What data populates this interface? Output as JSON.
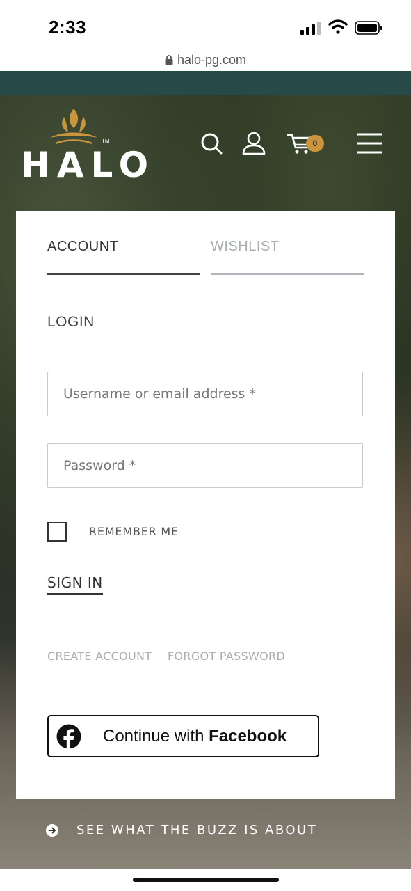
{
  "status": {
    "time": "2:33"
  },
  "browser": {
    "url": "halo-pg.com"
  },
  "header": {
    "logo_text": "HALO",
    "logo_tm": "TM",
    "cart_count": "0"
  },
  "tabs": [
    {
      "label": "ACCOUNT",
      "active": true
    },
    {
      "label": "WISHLIST",
      "active": false
    }
  ],
  "login": {
    "heading": "LOGIN",
    "username_placeholder": "Username or email address *",
    "password_placeholder": "Password *",
    "remember_label": "REMEMBER ME",
    "sign_in_label": "SIGN IN",
    "create_account_label": "CREATE ACCOUNT",
    "forgot_password_label": "FORGOT PASSWORD",
    "facebook_prefix": "Continue with ",
    "facebook_brand": "Facebook"
  },
  "footer": {
    "buzz_label": "SEE WHAT THE BUZZ IS ABOUT"
  },
  "colors": {
    "accent_gold": "#c9963e",
    "teal_strip": "#264a47",
    "tab_active": "#3f4447",
    "tab_inactive": "#b0b5bb"
  }
}
